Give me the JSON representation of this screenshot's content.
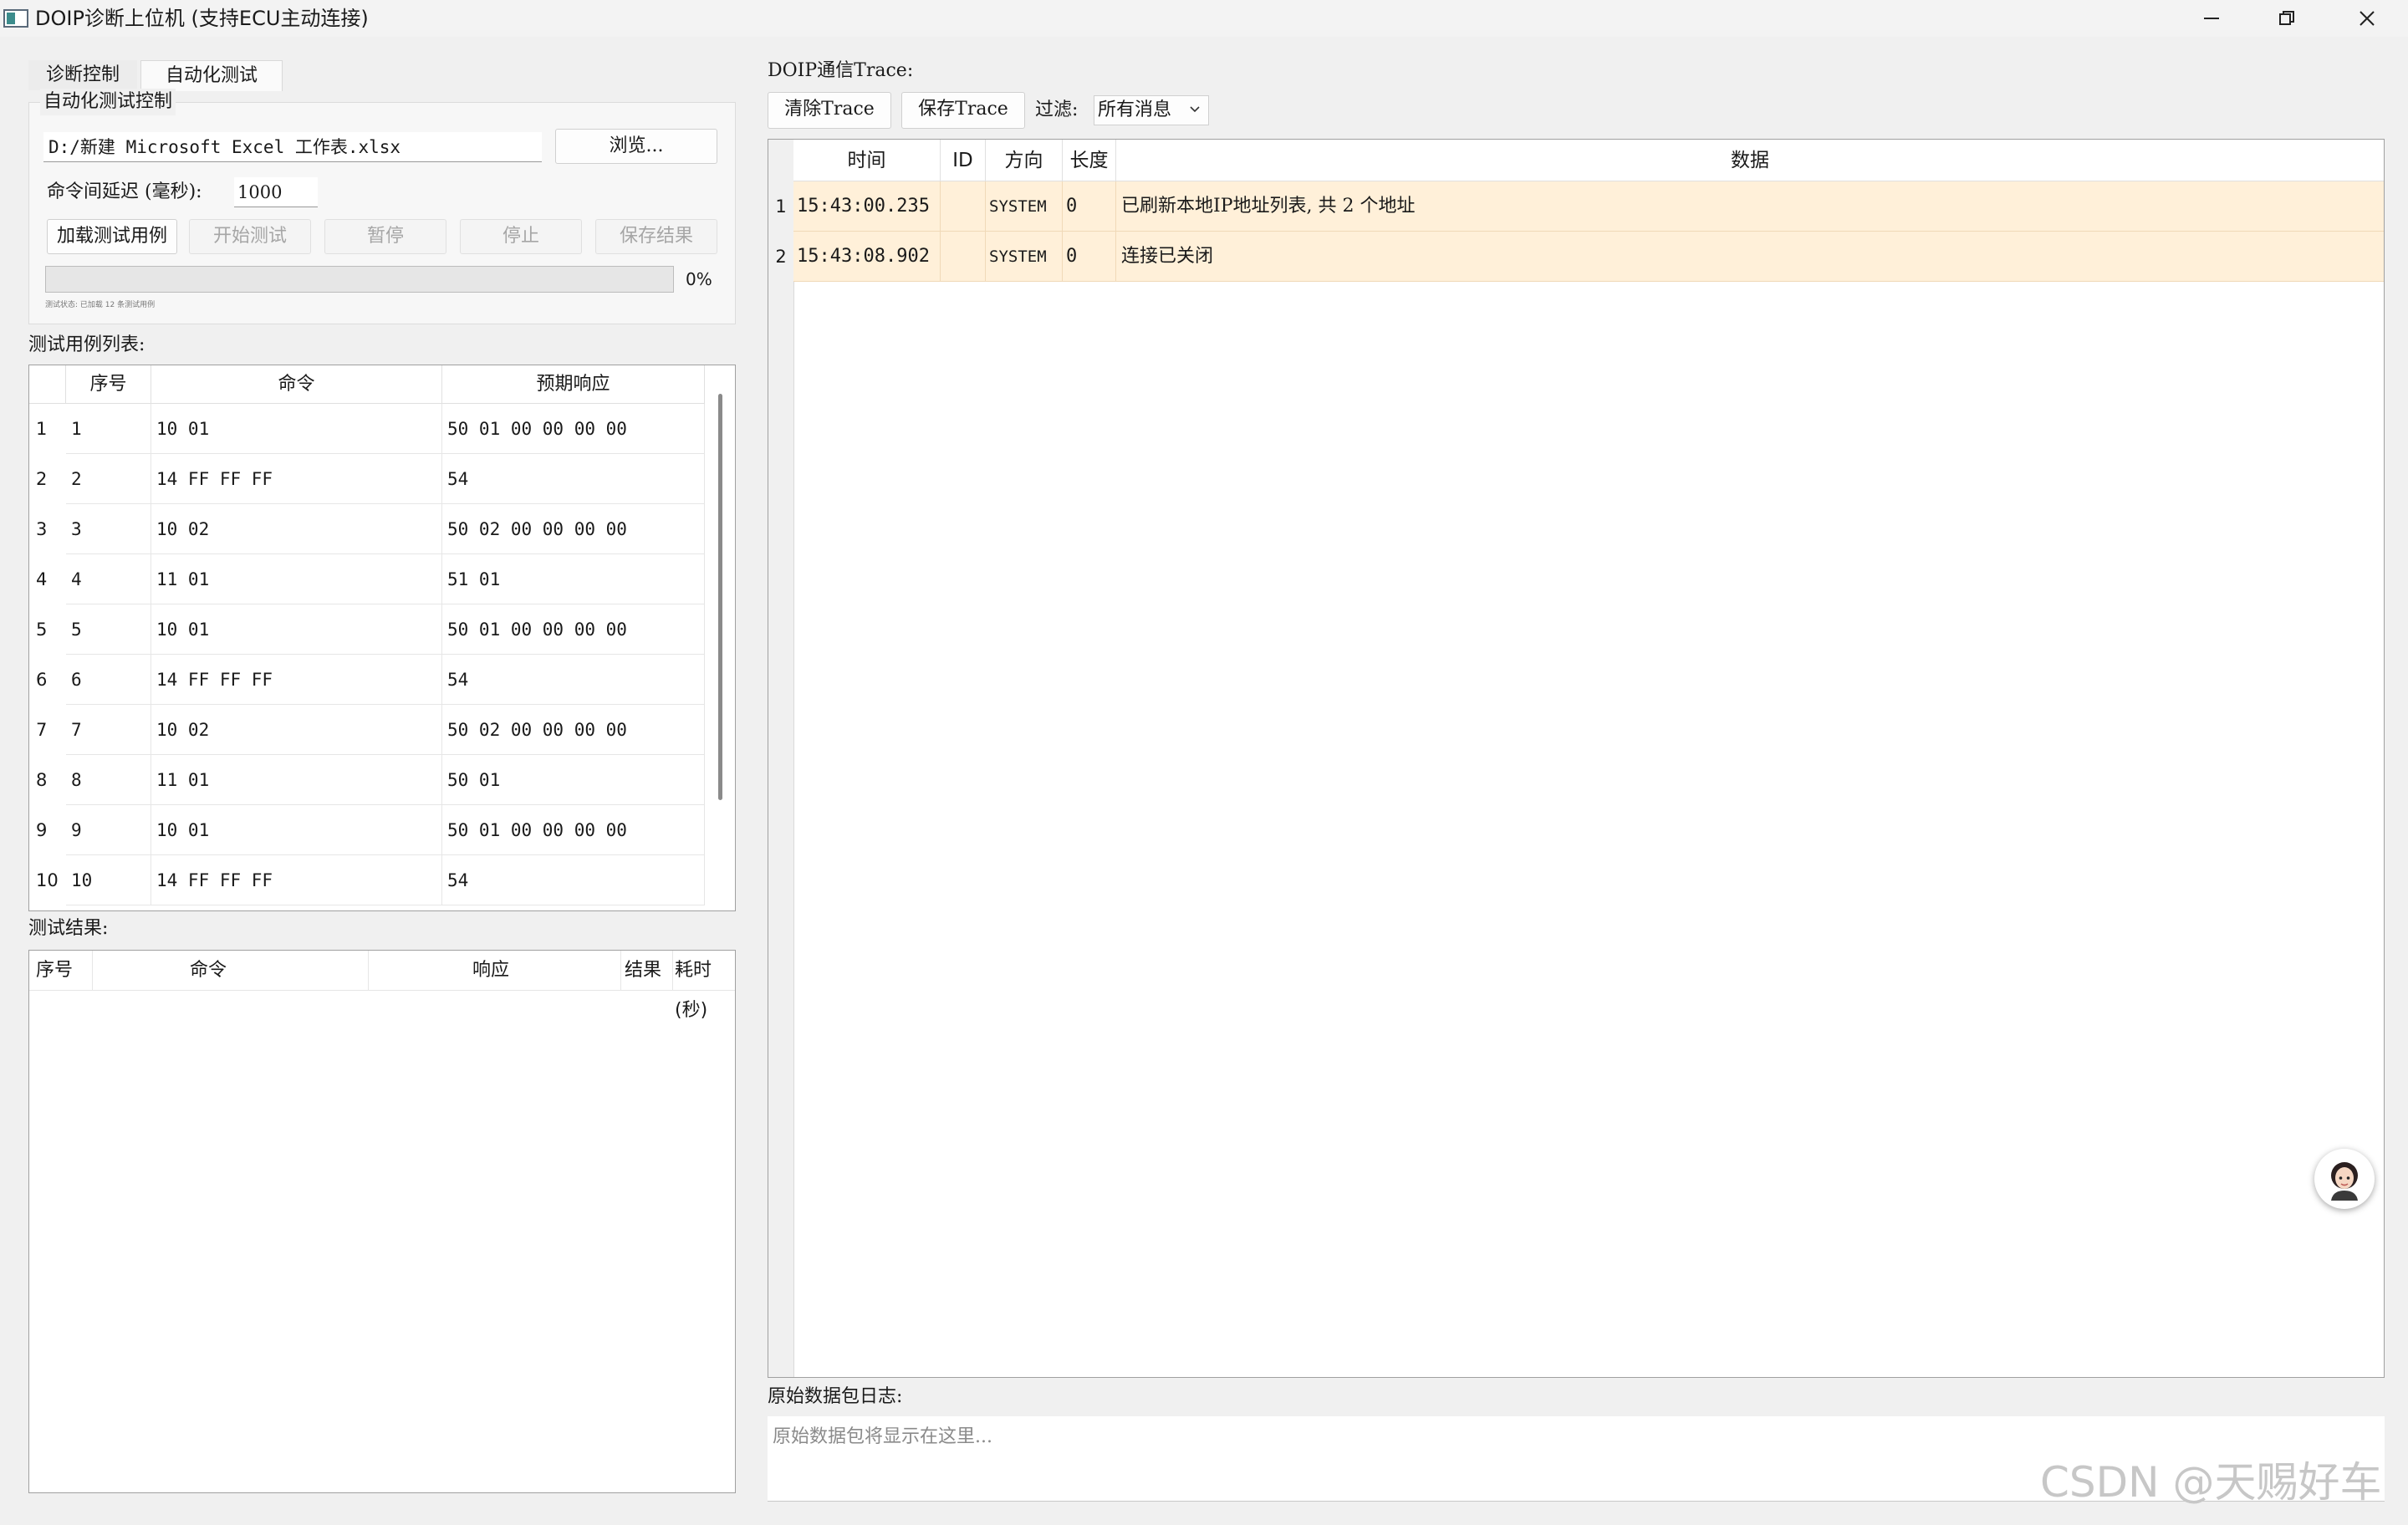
{
  "window": {
    "title": "DOIP诊断上位机 (支持ECU主动连接)"
  },
  "tabs": [
    {
      "label": "诊断控制",
      "active": false
    },
    {
      "label": "自动化测试",
      "active": true
    }
  ],
  "auto_test": {
    "group_title": "自动化测试控制",
    "file_path": "D:/新建 Microsoft Excel 工作表.xlsx",
    "browse_label": "浏览...",
    "delay_label": "命令间延迟 (毫秒):",
    "delay_value": "1000",
    "buttons": {
      "load": "加载测试用例",
      "start": "开始测试",
      "pause": "暂停",
      "stop": "停止",
      "save": "保存结果"
    },
    "progress": {
      "percent": 0,
      "text": "0%"
    },
    "status": "测试状态: 已加载 12 条测试用例"
  },
  "case_table": {
    "label": "测试用例列表:",
    "headers": [
      "序号",
      "命令",
      "预期响应"
    ],
    "rows": [
      {
        "num": "1",
        "seq": "1",
        "cmd": "10 01",
        "resp": "50 01 00 00 00 00"
      },
      {
        "num": "2",
        "seq": "2",
        "cmd": "14 FF FF FF",
        "resp": "54"
      },
      {
        "num": "3",
        "seq": "3",
        "cmd": "10 02",
        "resp": "50 02 00 00 00 00"
      },
      {
        "num": "4",
        "seq": "4",
        "cmd": "11 01",
        "resp": "51 01"
      },
      {
        "num": "5",
        "seq": "5",
        "cmd": "10 01",
        "resp": "50 01 00 00 00 00"
      },
      {
        "num": "6",
        "seq": "6",
        "cmd": "14 FF FF FF",
        "resp": "54"
      },
      {
        "num": "7",
        "seq": "7",
        "cmd": "10 02",
        "resp": "50 02 00 00 00 00"
      },
      {
        "num": "8",
        "seq": "8",
        "cmd": "11 01",
        "resp": "50 01"
      },
      {
        "num": "9",
        "seq": "9",
        "cmd": "10 01",
        "resp": "50 01 00 00 00 00"
      },
      {
        "num": "10",
        "seq": "10",
        "cmd": "14 FF FF FF",
        "resp": "54"
      }
    ]
  },
  "result_table": {
    "label": "测试结果:",
    "headers": [
      "序号",
      "命令",
      "响应",
      "结果",
      "耗时(秒)"
    ]
  },
  "trace": {
    "label": "DOIP通信Trace:",
    "clear_label": "清除Trace",
    "save_label": "保存Trace",
    "filter_label": "过滤:",
    "filter_value": "所有消息",
    "headers": [
      "时间",
      "ID",
      "方向",
      "长度",
      "数据"
    ],
    "rows": [
      {
        "num": "1",
        "time": "15:43:00.235",
        "id": "",
        "dir": "SYSTEM",
        "len": "0",
        "data": "已刷新本地IP地址列表, 共 2 个地址"
      },
      {
        "num": "2",
        "time": "15:43:08.902",
        "id": "",
        "dir": "SYSTEM",
        "len": "0",
        "data": "连接已关闭"
      }
    ],
    "row_color": "#fff0d9"
  },
  "raw_log": {
    "label": "原始数据包日志:",
    "placeholder": "原始数据包将显示在这里..."
  },
  "watermark": "CSDN @天赐好车",
  "colors": {
    "progress": "#06b025",
    "trace_row": "#fff0d9"
  }
}
